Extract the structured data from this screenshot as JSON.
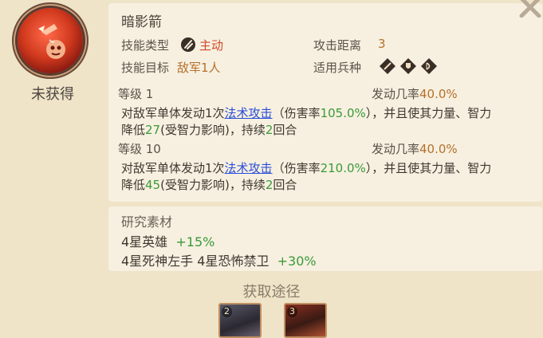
{
  "status_text": "未获得",
  "skill": {
    "name": "暗影箭",
    "type_label": "技能类型",
    "type_value": "主动",
    "range_label": "攻击距离",
    "range_value": "3",
    "target_label": "技能目标",
    "target_value": "敌军1人",
    "unit_label": "适用兵种",
    "unit_icons": [
      "sword-icon",
      "shield-icon",
      "bow-icon"
    ]
  },
  "levels": [
    {
      "level_label": "等级 1",
      "rate_label": "发动几率",
      "rate_value": "40.0%",
      "desc_pre": "对敌军单体发动1次",
      "desc_link": "法术攻击",
      "desc_mid": "（伤害率",
      "desc_dmg": "105.0%",
      "desc_mid2": "），并且使其力量、智力",
      "desc_line2_pre": "降低",
      "desc_reduce": "27",
      "desc_line2_mid": "(受智力影响)，持续",
      "desc_turns": "2",
      "desc_line2_post": "回合"
    },
    {
      "level_label": "等级 10",
      "rate_label": "发动几率",
      "rate_value": "40.0%",
      "desc_pre": "对敌军单体发动1次",
      "desc_link": "法术攻击",
      "desc_mid": "（伤害率",
      "desc_dmg": "210.0%",
      "desc_mid2": "），并且使其力量、智力",
      "desc_line2_pre": "降低",
      "desc_reduce": "45",
      "desc_line2_mid": "(受智力影响)，持续",
      "desc_turns": "2",
      "desc_line2_post": "回合"
    }
  ],
  "research": {
    "title": "研究素材",
    "rows": [
      {
        "text": "4星英雄",
        "bonus": "+15%"
      },
      {
        "text": "4星死神左手 4星恐怖禁卫",
        "bonus": "+30%"
      }
    ]
  },
  "acquire": {
    "title": "获取途径",
    "cards": [
      {
        "stars": "2"
      },
      {
        "stars": "3"
      }
    ]
  },
  "colors": {
    "background": "#efe3c8",
    "card": "#f7f0e0",
    "accent_brown": "#b5702c",
    "accent_red": "#d04a2a",
    "green": "#3a9a3a",
    "link": "#2a4ed8"
  }
}
